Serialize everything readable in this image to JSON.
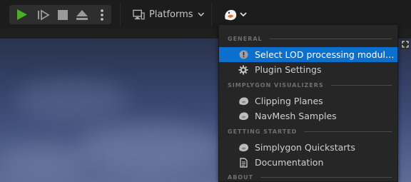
{
  "toolbar": {
    "platforms_label": "Platforms",
    "play_icon_color": "#4caf28"
  },
  "menu": {
    "sections": [
      {
        "header": "GENERAL",
        "items": [
          {
            "label": "Select LOD processing modules...",
            "icon": "warning-circle-icon",
            "selected": true
          },
          {
            "label": "Plugin Settings",
            "icon": "gear-icon",
            "selected": false
          }
        ]
      },
      {
        "header": "SIMPLYGON VISUALIZERS",
        "items": [
          {
            "label": "Clipping Planes",
            "icon": "simplygon-icon",
            "selected": false
          },
          {
            "label": "NavMesh Samples",
            "icon": "simplygon-icon",
            "selected": false
          }
        ]
      },
      {
        "header": "GETTING STARTED",
        "items": [
          {
            "label": "Simplygon Quickstarts",
            "icon": "simplygon-icon",
            "selected": false
          },
          {
            "label": "Documentation",
            "icon": "document-icon",
            "selected": false
          }
        ]
      },
      {
        "header": "ABOUT",
        "items": []
      }
    ],
    "selection_color": "#0b6fcf"
  }
}
